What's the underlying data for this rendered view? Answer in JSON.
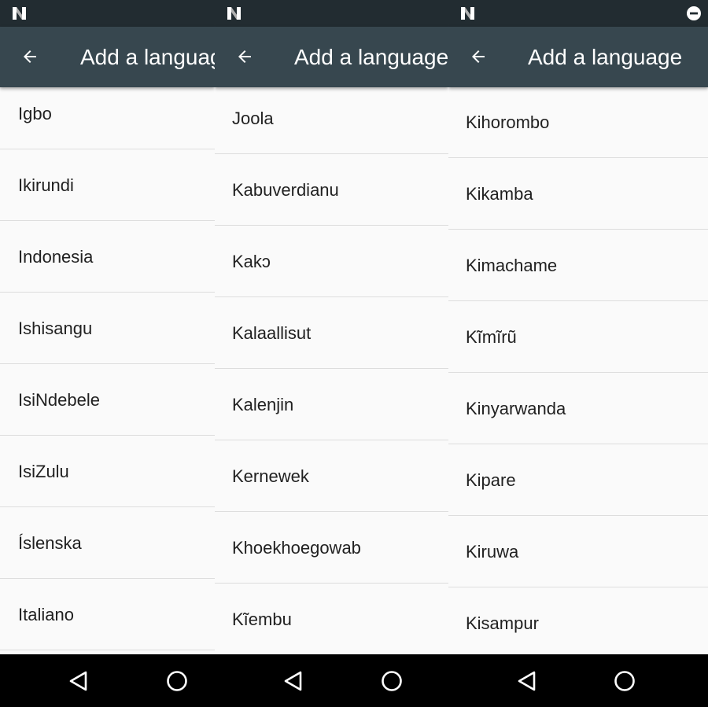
{
  "screens": [
    {
      "title": "Add a language",
      "languages": [
        "Igbo",
        "Ikirundi",
        "Indonesia",
        "Ishisangu",
        "IsiNdebele",
        "IsiZulu",
        "Íslenska",
        "Italiano"
      ]
    },
    {
      "title": "Add a language",
      "languages": [
        "Joola",
        "Kabuverdianu",
        "Kakɔ",
        "Kalaallisut",
        "Kalenjin",
        "Kernewek",
        "Khoekhoegowab",
        "Kĩembu"
      ]
    },
    {
      "title": "Add a language",
      "languages": [
        "Kihorombo",
        "Kikamba",
        "Kimachame",
        "Kĩmĩrũ",
        "Kinyarwanda",
        "Kipare",
        "Kiruwa",
        "Kisampur"
      ]
    }
  ],
  "icons": {
    "status_left": "android-n-icon",
    "status_right": "do-not-disturb-icon",
    "app_back": "arrow-back-icon",
    "nav_back": "nav-back-triangle-icon",
    "nav_home": "nav-home-circle-icon"
  },
  "colors": {
    "status_bar": "#222c31",
    "app_bar": "#37474f",
    "list_bg": "#fafafa",
    "divider": "#dddddd",
    "text": "#212121",
    "nav_bar": "#000000"
  }
}
